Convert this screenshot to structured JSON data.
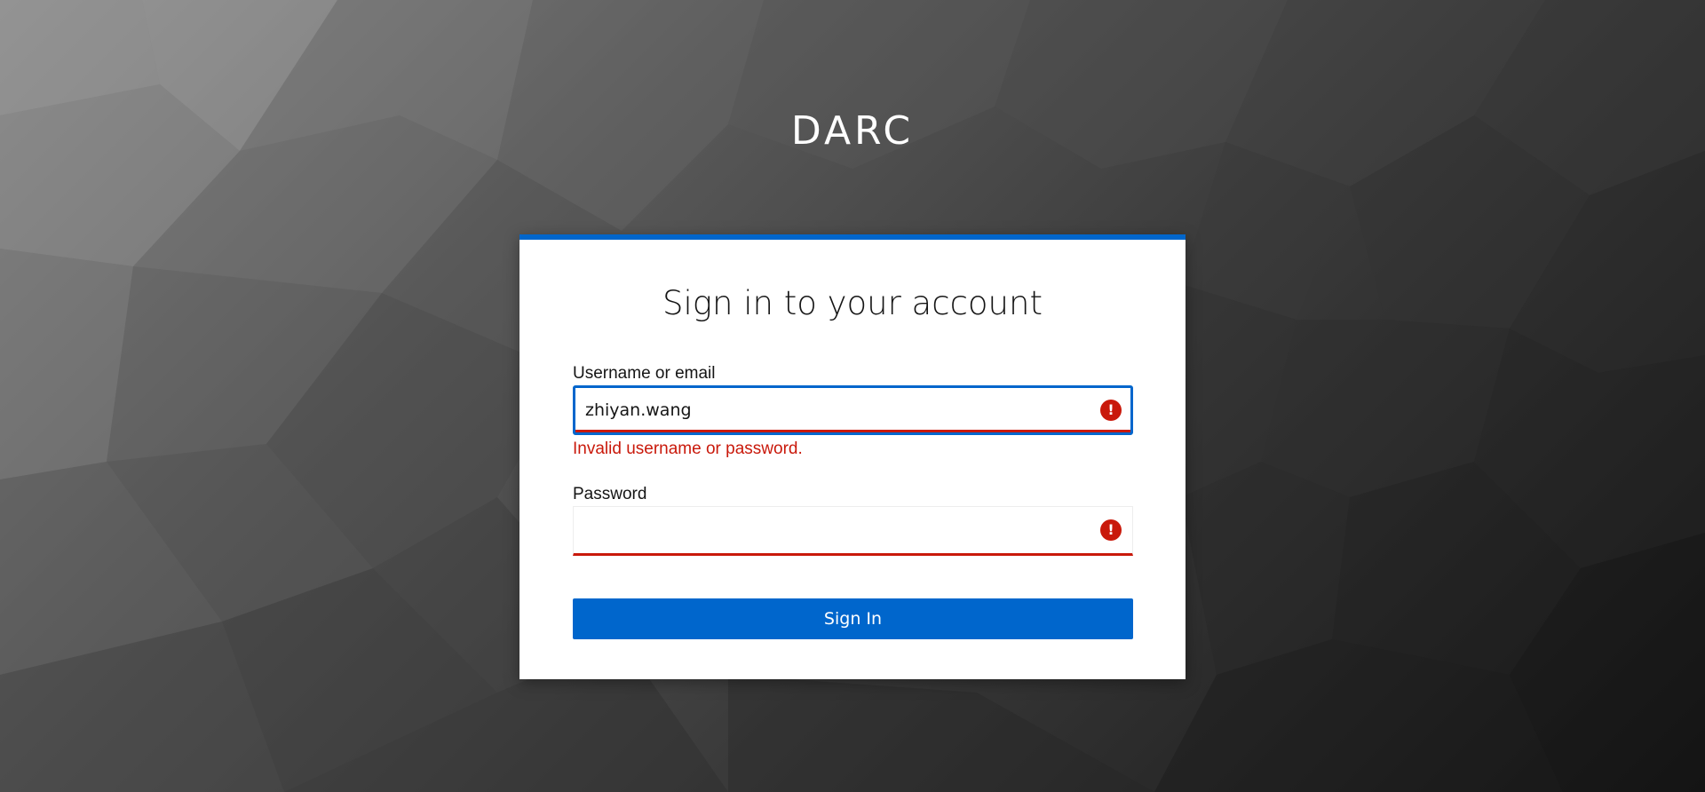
{
  "brand": {
    "title": "DARC"
  },
  "login": {
    "heading": "Sign in to your account",
    "username": {
      "label": "Username or email",
      "value": "zhiyan.wang"
    },
    "error_message": "Invalid username or password.",
    "password": {
      "label": "Password",
      "value": ""
    },
    "submit_label": "Sign In"
  },
  "icons": {
    "error": "exclamation-circle-icon"
  },
  "colors": {
    "accent": "#0066cc",
    "error": "#c9190b",
    "card_background": "#ffffff"
  }
}
